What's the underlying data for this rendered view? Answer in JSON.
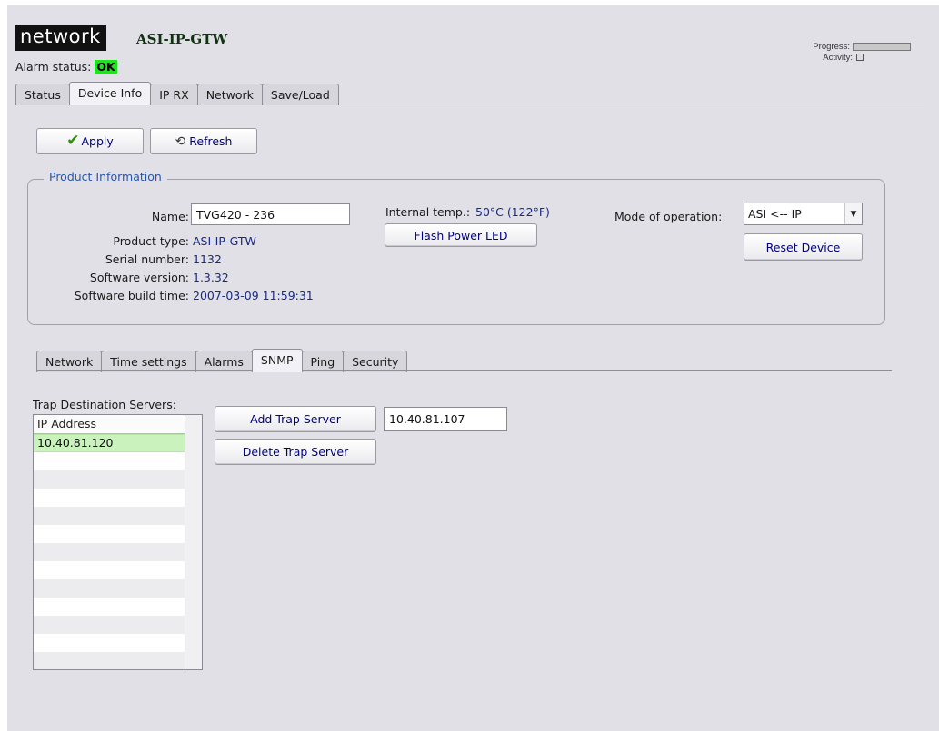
{
  "brand": {
    "logo_text": "network",
    "device_name": "ASI-IP-GTW"
  },
  "alarm": {
    "label": "Alarm status:",
    "value": "OK",
    "color": "#22e122"
  },
  "status_indicators": {
    "progress_label": "Progress:",
    "activity_label": "Activity:"
  },
  "main_tabs": [
    {
      "label": "Status"
    },
    {
      "label": "Device Info",
      "active": true
    },
    {
      "label": "IP RX"
    },
    {
      "label": "Network"
    },
    {
      "label": "Save/Load"
    }
  ],
  "toolbar": {
    "apply_label": "Apply",
    "refresh_label": "Refresh"
  },
  "product_info": {
    "legend": "Product Information",
    "name_label": "Name:",
    "name_value": "TVG420 - 236",
    "product_type_label": "Product type:",
    "product_type_value": "ASI-IP-GTW",
    "serial_label": "Serial number:",
    "serial_value": "1132",
    "sw_version_label": "Software version:",
    "sw_version_value": "1.3.32",
    "build_time_label": "Software build time:",
    "build_time_value": "2007-03-09 11:59:31",
    "temp_label": "Internal temp.:",
    "temp_value": "50°C (122°F)",
    "flash_led_label": "Flash Power LED",
    "mode_label": "Mode of operation:",
    "mode_value": "ASI <-- IP",
    "reset_label": "Reset Device"
  },
  "sub_tabs": [
    {
      "label": "Network"
    },
    {
      "label": "Time settings"
    },
    {
      "label": "Alarms"
    },
    {
      "label": "SNMP",
      "active": true
    },
    {
      "label": "Ping"
    },
    {
      "label": "Security"
    }
  ],
  "trap": {
    "section_label": "Trap Destination Servers:",
    "column_header": "IP Address",
    "rows": [
      "10.40.81.120"
    ],
    "add_label": "Add Trap Server",
    "delete_label": "Delete Trap Server",
    "input_value": "10.40.81.107"
  },
  "colors": {
    "accent_blue": "#1a2a80",
    "selected_row": "#c9f2bd",
    "page_bg": "#e0e0e6"
  }
}
